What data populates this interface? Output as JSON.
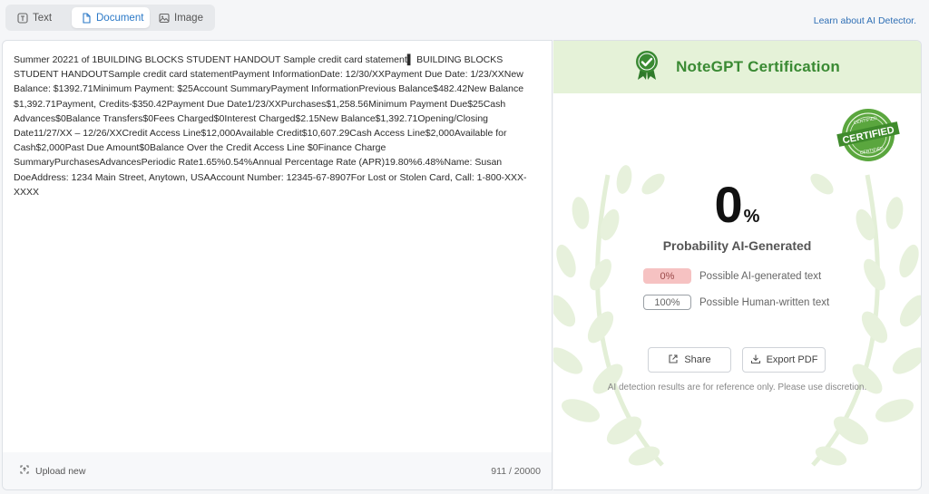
{
  "tabs": [
    {
      "label": "Text",
      "icon": "text-icon",
      "active": false
    },
    {
      "label": "Document",
      "icon": "document-icon",
      "active": true
    },
    {
      "label": "Image",
      "icon": "image-icon",
      "active": false
    }
  ],
  "header": {
    "learn_link": "Learn about AI Detector."
  },
  "document": {
    "text": "Summer 20221 of 1BUILDING BLOCKS STUDENT HANDOUT Sample credit card statement▌ BUILDING BLOCKS STUDENT HANDOUTSample credit card statementPayment InformationDate: 12/30/XXPayment Due Date: 1/23/XXNew Balance: $1392.71Minimum Payment: $25Account SummaryPayment InformationPrevious Balance$482.42New Balance $1,392.71Payment, Credits-$350.42Payment Due Date1/23/XXPurchases$1,258.56Minimum Payment Due$25Cash Advances$0Balance Transfers$0Fees Charged$0Interest Charged$2.15New Balance$1,392.71Opening/Closing Date11/27/XX – 12/26/XXCredit Access Line$12,000Available Credit$10,607.29Cash Access Line$2,000Available for Cash$2,000Past Due Amount$0Balance Over the Credit Access Line $0Finance Charge SummaryPurchasesAdvancesPeriodic Rate1.65%0.54%Annual Percentage Rate (APR)19.80%6.48%Name: Susan DoeAddress: 1234 Main Street, Anytown, USAAccount Number: 12345-67-8907For Lost or Stolen Card, Call: 1-800-XXX-XXXX",
    "upload_label": "Upload new",
    "counter": "911 / 20000"
  },
  "result": {
    "title": "NoteGPT Certification",
    "stamp_text": "CERTIFIED",
    "stamp_small_text": "CERTIFIED",
    "percent": "0",
    "percent_sign": "%",
    "probability_label": "Probability AI-Generated",
    "ai_value": "0%",
    "ai_label": "Possible AI-generated text",
    "human_value": "100%",
    "human_label": "Possible Human-written text",
    "share_label": "Share",
    "export_label": "Export PDF",
    "disclaimer": "AI detection results are for reference only. Please use discretion."
  },
  "colors": {
    "accent_blue": "#2a78c7",
    "cert_green": "#3a8a33",
    "header_green": "#e5f2d8",
    "ai_pill": "#f6c2c2"
  }
}
